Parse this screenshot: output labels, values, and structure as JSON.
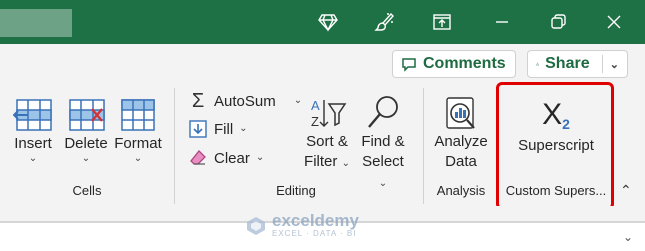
{
  "titlebar": {
    "icons": [
      "diamond-icon",
      "brush-icon",
      "ribbon-display-icon",
      "minimize-icon",
      "restore-icon",
      "close-icon"
    ],
    "bg_color": "#1e7145"
  },
  "header_buttons": {
    "comments_label": "Comments",
    "share_label": "Share",
    "accent": "#1e6b41"
  },
  "groups": {
    "cells": {
      "label": "Cells",
      "buttons": [
        {
          "label": "Insert",
          "icon": "insert-cells-icon"
        },
        {
          "label": "Delete",
          "icon": "delete-cells-icon"
        },
        {
          "label": "Format",
          "icon": "format-cells-icon"
        }
      ]
    },
    "editing": {
      "label": "Editing",
      "autosum": "AutoSum",
      "fill": "Fill",
      "clear": "Clear",
      "sort_filter_line1": "Sort &",
      "sort_filter_line2": "Filter",
      "find_select_line1": "Find &",
      "find_select_line2": "Select"
    },
    "analysis": {
      "label": "Analysis",
      "analyze_line1": "Analyze",
      "analyze_line2": "Data"
    },
    "custom": {
      "label": "Custom Supers...",
      "superscript_label": "Superscript",
      "superscript_glyph": "X",
      "superscript_exp": "2"
    }
  },
  "watermark": {
    "name": "exceldemy",
    "sub": "EXCEL · DATA · BI"
  },
  "highlight_color": "#e00000"
}
